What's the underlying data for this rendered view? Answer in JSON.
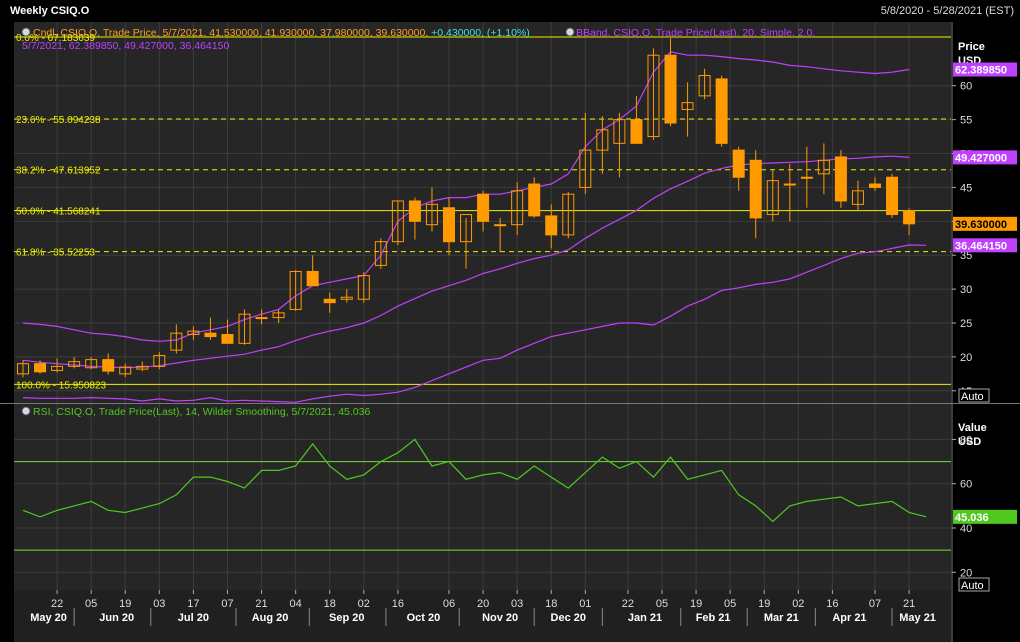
{
  "window": {
    "title": "Weekly CSIQ.O",
    "date_range": "5/8/2020 - 5/28/2021 (EST)"
  },
  "colors": {
    "background": "#000000",
    "panel_bg": "#262626",
    "grid": "#3c3c3c",
    "candle": "#ff9a00",
    "bband": "#c040ff",
    "fib": "#f0f000",
    "rsi": "#50c820",
    "rsi_bands": "#70e030",
    "text": "#ffffff"
  },
  "legend": {
    "candle_text": "Cndl, CSIQ.O, Trade Price, 5/7/2021, 41.530000, 41.930000, 37.980000, 39.630000, ",
    "candle_change": "+0.430000, (+1.10%)",
    "bband_text_line1": "BBand, CSIQ.O, Trade Price(Last),  20, Simple, 2.0,",
    "bband_text_line2": "5/7/2021, 62.389850, 49.427000, 36.464150",
    "rsi_text": "RSI, CSIQ.O, Trade Price(Last),  14, Wilder Smoothing, 5/7/2021, 45.036"
  },
  "price_axis": {
    "title": "Price",
    "unit": "USD",
    "ticks": [
      15,
      20,
      25,
      30,
      35,
      40,
      45,
      50,
      55,
      60
    ],
    "ymin": 13.2,
    "ymax": 69.4,
    "auto_label": "Auto",
    "last_price_label": "39.630000",
    "bband_upper_label": "62.389850",
    "bband_mid_label": "49.427000",
    "bband_lower_label": "36.464150"
  },
  "rsi_axis": {
    "title": "Value",
    "unit": "USD",
    "ticks": [
      20,
      40,
      60,
      80
    ],
    "ymin": 12,
    "ymax": 96,
    "auto_label": "Auto",
    "current_label": "45.036",
    "upper_band": 70,
    "lower_band": 30
  },
  "x_axis": {
    "ticks": [
      {
        "w": 2,
        "label": "22"
      },
      {
        "w": 4,
        "label": "05"
      },
      {
        "w": 6,
        "label": "19"
      },
      {
        "w": 8,
        "label": "03"
      },
      {
        "w": 10,
        "label": "17"
      },
      {
        "w": 12,
        "label": "07"
      },
      {
        "w": 14,
        "label": "21"
      },
      {
        "w": 16,
        "label": "04"
      },
      {
        "w": 18,
        "label": "18"
      },
      {
        "w": 20,
        "label": "02"
      },
      {
        "w": 22,
        "label": "16"
      },
      {
        "w": 25,
        "label": "06"
      },
      {
        "w": 27,
        "label": "20"
      },
      {
        "w": 29,
        "label": "03"
      },
      {
        "w": 31,
        "label": "18"
      },
      {
        "w": 33,
        "label": "01"
      },
      {
        "w": 35.5,
        "label": "22"
      },
      {
        "w": 37.5,
        "label": "05"
      },
      {
        "w": 39.5,
        "label": "19"
      },
      {
        "w": 41.5,
        "label": "05"
      },
      {
        "w": 43.5,
        "label": "19"
      },
      {
        "w": 45.5,
        "label": "02"
      },
      {
        "w": 47.5,
        "label": "16"
      },
      {
        "w": 50,
        "label": "07"
      },
      {
        "w": 52,
        "label": "21"
      }
    ],
    "months": [
      {
        "w": 1.5,
        "label": "May 20"
      },
      {
        "w": 5.5,
        "label": "Jun 20"
      },
      {
        "w": 10,
        "label": "Jul 20"
      },
      {
        "w": 14.5,
        "label": "Aug 20"
      },
      {
        "w": 19,
        "label": "Sep 20"
      },
      {
        "w": 23.5,
        "label": "Oct 20"
      },
      {
        "w": 28,
        "label": "Nov 20"
      },
      {
        "w": 32,
        "label": "Dec 20"
      },
      {
        "w": 36.5,
        "label": "Jan 21"
      },
      {
        "w": 40.5,
        "label": "Feb 21"
      },
      {
        "w": 44.5,
        "label": "Mar 21"
      },
      {
        "w": 48.5,
        "label": "Apr 21"
      },
      {
        "w": 52.5,
        "label": "May 21"
      }
    ]
  },
  "chart_data": {
    "type": "candlestick",
    "title": "Weekly CSIQ.O",
    "instrument": "CSIQ.O",
    "period": "5/8/2020 - 5/28/2021",
    "ylabel": "Price USD",
    "candles": [
      {
        "o": 17.5,
        "h": 19.5,
        "l": 17.0,
        "c": 19.0
      },
      {
        "o": 19.0,
        "h": 19.5,
        "l": 17.5,
        "c": 17.8
      },
      {
        "o": 18.0,
        "h": 19.8,
        "l": 17.7,
        "c": 18.6
      },
      {
        "o": 18.6,
        "h": 20.0,
        "l": 18.3,
        "c": 19.3
      },
      {
        "o": 18.4,
        "h": 20.0,
        "l": 18.2,
        "c": 19.6
      },
      {
        "o": 19.6,
        "h": 20.5,
        "l": 17.4,
        "c": 17.9
      },
      {
        "o": 17.5,
        "h": 19.0,
        "l": 17.0,
        "c": 18.5
      },
      {
        "o": 18.2,
        "h": 19.3,
        "l": 17.9,
        "c": 18.6
      },
      {
        "o": 18.6,
        "h": 20.7,
        "l": 18.2,
        "c": 20.2
      },
      {
        "o": 21.0,
        "h": 24.8,
        "l": 20.5,
        "c": 23.5
      },
      {
        "o": 23.3,
        "h": 24.5,
        "l": 22.5,
        "c": 23.8
      },
      {
        "o": 23.5,
        "h": 25.8,
        "l": 22.5,
        "c": 23.0
      },
      {
        "o": 23.3,
        "h": 25.5,
        "l": 22.0,
        "c": 22.0
      },
      {
        "o": 22.0,
        "h": 27.0,
        "l": 21.8,
        "c": 26.3
      },
      {
        "o": 25.8,
        "h": 27.0,
        "l": 24.8,
        "c": 25.8
      },
      {
        "o": 25.8,
        "h": 27.0,
        "l": 25.0,
        "c": 26.5
      },
      {
        "o": 27.0,
        "h": 32.8,
        "l": 26.8,
        "c": 32.6
      },
      {
        "o": 32.6,
        "h": 35.0,
        "l": 30.5,
        "c": 30.5
      },
      {
        "o": 28.5,
        "h": 29.5,
        "l": 26.5,
        "c": 28.0
      },
      {
        "o": 28.5,
        "h": 30.0,
        "l": 28.0,
        "c": 28.8
      },
      {
        "o": 28.5,
        "h": 32.5,
        "l": 28.0,
        "c": 32.0
      },
      {
        "o": 33.5,
        "h": 37.5,
        "l": 33.0,
        "c": 37.0
      },
      {
        "o": 37.0,
        "h": 43.0,
        "l": 36.5,
        "c": 43.0
      },
      {
        "o": 43.0,
        "h": 43.5,
        "l": 37.3,
        "c": 40.0
      },
      {
        "o": 39.5,
        "h": 45.0,
        "l": 38.5,
        "c": 42.5
      },
      {
        "o": 42.0,
        "h": 43.5,
        "l": 35.0,
        "c": 37.0
      },
      {
        "o": 37.0,
        "h": 40.5,
        "l": 33.0,
        "c": 41.0
      },
      {
        "o": 44.0,
        "h": 44.5,
        "l": 38.5,
        "c": 40.0
      },
      {
        "o": 39.5,
        "h": 40.5,
        "l": 35.5,
        "c": 39.5
      },
      {
        "o": 39.5,
        "h": 45.8,
        "l": 38.0,
        "c": 44.5
      },
      {
        "o": 45.5,
        "h": 46.5,
        "l": 40.5,
        "c": 40.8
      },
      {
        "o": 40.8,
        "h": 42.5,
        "l": 36.0,
        "c": 38.0
      },
      {
        "o": 38.0,
        "h": 44.3,
        "l": 37.5,
        "c": 44.0
      },
      {
        "o": 45.0,
        "h": 56.0,
        "l": 44.0,
        "c": 50.5
      },
      {
        "o": 50.5,
        "h": 55.5,
        "l": 47.0,
        "c": 53.5
      },
      {
        "o": 51.5,
        "h": 56.0,
        "l": 46.5,
        "c": 55.0
      },
      {
        "o": 55.0,
        "h": 58.5,
        "l": 51.5,
        "c": 51.5
      },
      {
        "o": 52.5,
        "h": 65.5,
        "l": 52.0,
        "c": 64.5
      },
      {
        "o": 64.5,
        "h": 67.0,
        "l": 54.0,
        "c": 54.5
      },
      {
        "o": 56.5,
        "h": 60.5,
        "l": 52.5,
        "c": 57.5
      },
      {
        "o": 58.5,
        "h": 62.5,
        "l": 58.0,
        "c": 61.5
      },
      {
        "o": 61.0,
        "h": 61.5,
        "l": 51.0,
        "c": 51.5
      },
      {
        "o": 50.5,
        "h": 51.0,
        "l": 44.5,
        "c": 46.5
      },
      {
        "o": 49.0,
        "h": 50.5,
        "l": 37.5,
        "c": 40.5
      },
      {
        "o": 41.0,
        "h": 47.5,
        "l": 40.0,
        "c": 46.0
      },
      {
        "o": 45.5,
        "h": 48.5,
        "l": 40.0,
        "c": 45.5
      },
      {
        "o": 46.5,
        "h": 51.0,
        "l": 42.0,
        "c": 46.5
      },
      {
        "o": 47.0,
        "h": 51.5,
        "l": 44.0,
        "c": 49.0
      },
      {
        "o": 49.5,
        "h": 50.5,
        "l": 42.0,
        "c": 43.0
      },
      {
        "o": 42.5,
        "h": 46.0,
        "l": 41.5,
        "c": 44.5
      },
      {
        "o": 45.5,
        "h": 46.5,
        "l": 44.5,
        "c": 45.0
      },
      {
        "o": 46.5,
        "h": 47.0,
        "l": 40.5,
        "c": 41.0
      },
      {
        "o": 41.53,
        "h": 41.93,
        "l": 37.98,
        "c": 39.63
      }
    ],
    "bband_upper": [
      25,
      24.8,
      24.5,
      24.0,
      23.5,
      23.3,
      23.0,
      22.5,
      22.3,
      22.5,
      23.5,
      24.0,
      24.5,
      25.5,
      26.3,
      27.0,
      29.0,
      30.5,
      31.0,
      31.5,
      32.0,
      35.0,
      40.0,
      42.0,
      43.0,
      43.5,
      43.5,
      44.0,
      44.0,
      44.5,
      45.0,
      45.5,
      47.0,
      51.0,
      53.5,
      55.0,
      57.0,
      62.0,
      65.0,
      64.5,
      64.5,
      64.3,
      64.0,
      63.8,
      63.5,
      63.0,
      62.8,
      62.5,
      62.2,
      62.0,
      61.8,
      62.0,
      62.39
    ],
    "bband_mid": [
      19.5,
      19.2,
      19.0,
      18.8,
      18.6,
      18.5,
      18.4,
      18.5,
      18.7,
      19.1,
      19.5,
      19.8,
      20.1,
      20.4,
      21.0,
      21.5,
      22.4,
      23.2,
      23.8,
      24.3,
      25.0,
      26.1,
      27.5,
      28.6,
      29.7,
      30.5,
      31.3,
      32.3,
      33.0,
      33.8,
      34.5,
      35.0,
      35.8,
      37.5,
      39.0,
      40.3,
      41.6,
      43.4,
      44.8,
      45.9,
      47.1,
      47.8,
      48.3,
      48.5,
      48.6,
      48.7,
      48.8,
      49.0,
      49.2,
      49.3,
      49.5,
      49.6,
      49.43
    ],
    "bband_lower": [
      14.0,
      13.9,
      13.9,
      13.9,
      14.0,
      13.9,
      13.8,
      13.5,
      13.8,
      13.5,
      13.6,
      14.0,
      13.5,
      13.6,
      13.5,
      13.4,
      13.3,
      13.8,
      14.2,
      14.5,
      14.3,
      14.5,
      14.8,
      15.5,
      16.5,
      17.5,
      18.5,
      19.5,
      19.8,
      21.0,
      22.0,
      23.0,
      23.5,
      24.0,
      24.5,
      25.0,
      25.0,
      24.7,
      26.0,
      27.5,
      28.5,
      29.8,
      30.2,
      30.7,
      31.0,
      31.5,
      32.5,
      33.5,
      34.5,
      35.3,
      35.5,
      36.0,
      36.5,
      36.46
    ],
    "fibonacci": [
      {
        "label": "0.0% - 67.183639",
        "value": 67.183639,
        "style": "solid"
      },
      {
        "label": "23.6% - 55.094238",
        "value": 55.094238,
        "style": "dashed"
      },
      {
        "label": "38.2% - 47.613952",
        "value": 47.613952,
        "style": "dashed"
      },
      {
        "label": "50.0% - 41.568241",
        "value": 41.568241,
        "style": "solid"
      },
      {
        "label": "61.8% - 35.52253",
        "value": 35.52253,
        "style": "dashed"
      },
      {
        "label": "100.0% - 15.950823",
        "value": 15.950823,
        "style": "solid"
      }
    ],
    "rsi": [
      48,
      45,
      48,
      50,
      52,
      48,
      47,
      49,
      51,
      55,
      63,
      63,
      61,
      58,
      66,
      66,
      68,
      78,
      68,
      62,
      64,
      70,
      74,
      80,
      68,
      70,
      62,
      64,
      65,
      62,
      68,
      63,
      58,
      65,
      72,
      67,
      70,
      63,
      72,
      62,
      64,
      66,
      55,
      50,
      43,
      50,
      52,
      53,
      54,
      50,
      51,
      52,
      47,
      45.036
    ]
  }
}
